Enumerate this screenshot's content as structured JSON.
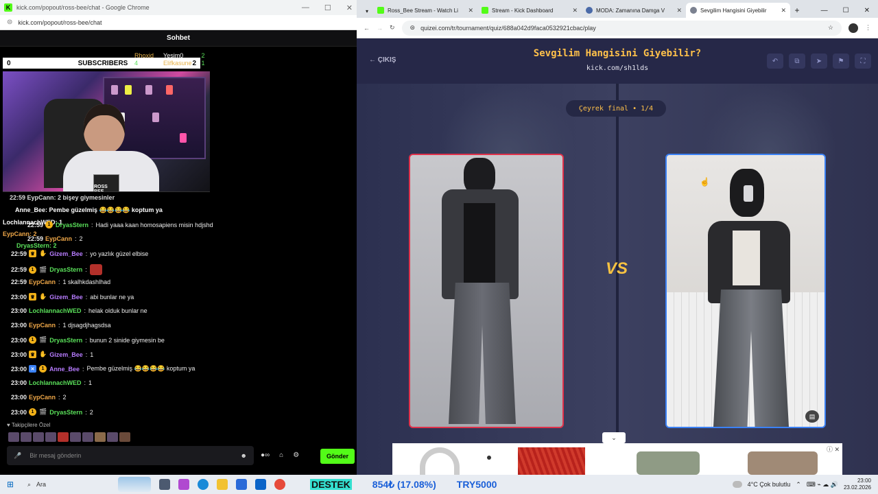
{
  "left_window": {
    "title": "kick.com/popout/ross-bee/chat - Google Chrome",
    "url": "kick.com/popout/ross-bee/chat",
    "chat_title": "Sohbet",
    "subscribers_bar": {
      "left_count": "0",
      "label": "SUBSCRIBERS",
      "right_count": "2"
    },
    "leaderboard": [
      {
        "name": "Rhoxid",
        "value": ""
      },
      {
        "name": "Yesim0",
        "value": "2"
      },
      {
        "name": "Elifkasune",
        "value": "1"
      },
      {
        "name": "",
        "value": "4"
      }
    ],
    "stream_logo": "ROSS BEE",
    "overlay_lines": [
      "22:59 EypCann: 2 bişey giymesinler",
      "Anne_Bee: Pembe güzelmiş 😂😂😂😂 koptum ya",
      "LochlannachWED: 1",
      "EypCann: 2",
      "DryasStern: 2"
    ],
    "messages": [
      {
        "time": "22:59",
        "user": "DryasStern",
        "color": "#5ae05a",
        "text": "Hadi yaaa kaan homosapiens misin hdjshd"
      },
      {
        "time": "22:59",
        "user": "EypCann",
        "color": "#f0a848",
        "text": "2"
      },
      {
        "time": "22:59",
        "user": "Gizem_Bee",
        "color": "#b77cff",
        "text": "yo yazlık güzel elbise"
      },
      {
        "time": "22:59",
        "user": "DryasStern",
        "color": "#5ae05a",
        "text": ""
      },
      {
        "time": "22:59",
        "user": "EypCann",
        "color": "#f0a848",
        "text": "1 skalhkdashlhad"
      },
      {
        "time": "23:00",
        "user": "Gizem_Bee",
        "color": "#b77cff",
        "text": "abi bunlar ne ya"
      },
      {
        "time": "23:00",
        "user": "LochlannachWED",
        "color": "#5ae05a",
        "text": "helak olduk bunlar ne"
      },
      {
        "time": "23:00",
        "user": "EypCann",
        "color": "#f0a848",
        "text": "1 djsagdjhagsdsa"
      },
      {
        "time": "23:00",
        "user": "DryasStern",
        "color": "#5ae05a",
        "text": "bunun 2 sinide giymesin be"
      },
      {
        "time": "23:00",
        "user": "Gizem_Bee",
        "color": "#b77cff",
        "text": "1"
      },
      {
        "time": "23:00",
        "user": "Anne_Bee",
        "color": "#b77cff",
        "text": "Pembe güzelmiş 😂😂😂😂 koptum ya"
      },
      {
        "time": "23:00",
        "user": "LochlannachWED",
        "color": "#5ae05a",
        "text": "1"
      },
      {
        "time": "23:00",
        "user": "EypCann",
        "color": "#f0a848",
        "text": "2"
      },
      {
        "time": "23:00",
        "user": "DryasStern",
        "color": "#5ae05a",
        "text": "2"
      }
    ],
    "followers_only": "Takipçilere Özel",
    "input_placeholder": "Bir mesaj gönderin",
    "send_label": "Gönder"
  },
  "right_window": {
    "tabs": [
      {
        "label": "Ross_Bee Stream - Watch Li",
        "color": "#53fc18",
        "active": false
      },
      {
        "label": "Stream - Kick Dashboard",
        "color": "#53fc18",
        "active": false
      },
      {
        "label": "MODA: Zamanına Damga V",
        "color": "#4a6aa8",
        "active": false
      },
      {
        "label": "Sevgilim Hangisini Giyebilir",
        "color": "#7b8190",
        "active": true
      }
    ],
    "url": "quizei.com/tr/tournament/quiz/688a042d9faca0532921cbac/play",
    "exit_label": "← ÇIKIŞ",
    "quiz_title": "Sevgilim Hangisini Giyebilir?",
    "quiz_subtitle": "kick.com/sh1lds",
    "round_label": "Çeyrek final • 1/4",
    "vs_label": "VS"
  },
  "taskbar": {
    "search": "Ara",
    "ticker": [
      "DESTEK",
      "854₺ (17.08%)",
      "TRY5000"
    ],
    "weather": "4°C  Çok bulutlu",
    "time": "23:00",
    "date": "23.02.2026"
  }
}
